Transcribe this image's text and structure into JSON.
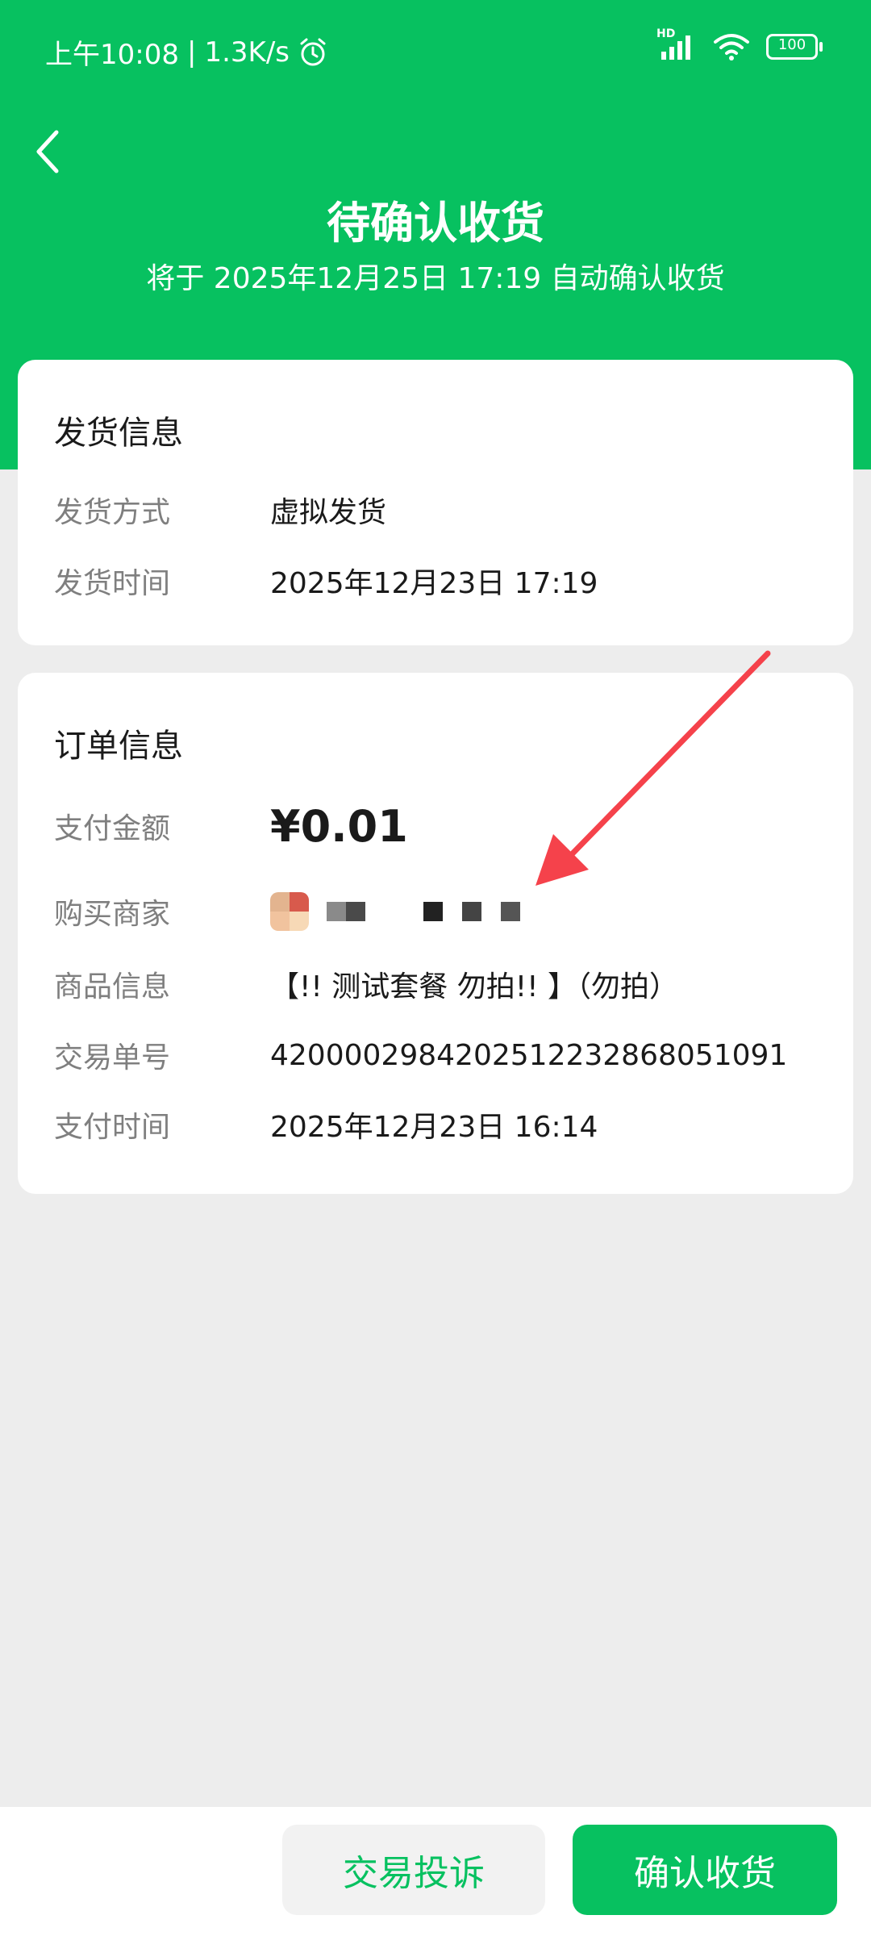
{
  "status_bar": {
    "time": "上午10:08",
    "speed": "1.3K/s",
    "network_tag": "HD",
    "battery": "100"
  },
  "header": {
    "title": "待确认收货",
    "subtitle": "将于 2025年12月25日 17:19 自动确认收货"
  },
  "shipping": {
    "title": "发货信息",
    "rows": [
      {
        "label": "发货方式",
        "value": "虚拟发货"
      },
      {
        "label": "发货时间",
        "value": "2025年12月23日 17:19"
      }
    ]
  },
  "order": {
    "title": "订单信息",
    "amount_label": "支付金额",
    "amount": "¥0.01",
    "merchant_label": "购买商家",
    "product_label": "商品信息",
    "product_value": "【!! 测试套餐 勿拍!! 】（勿拍）",
    "txn_label": "交易单号",
    "txn_value": "4200002984202512232868051091",
    "paytime_label": "支付时间",
    "paytime_value": "2025年12月23日 16:14"
  },
  "actions": {
    "complain": "交易投诉",
    "confirm": "确认收货"
  },
  "colors": {
    "brand": "#07c160",
    "background": "#ededed",
    "annotation_arrow": "#f5424b"
  }
}
